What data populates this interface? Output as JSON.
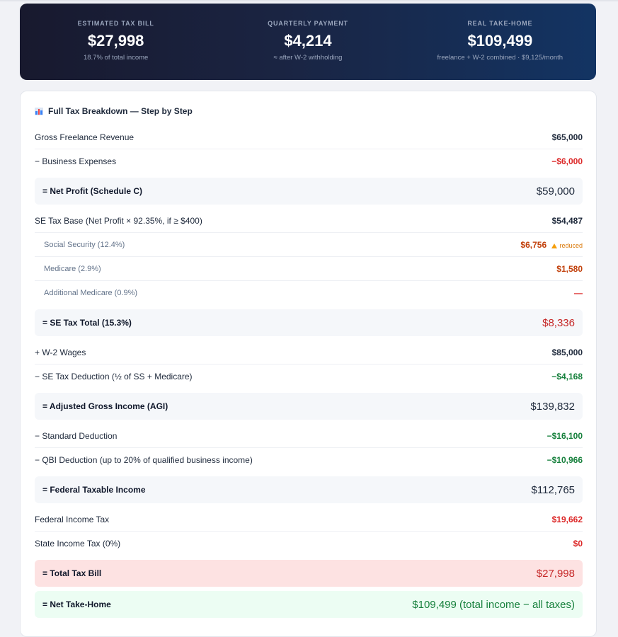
{
  "hero": {
    "stats": [
      {
        "label": "ESTIMATED TAX BILL",
        "value": "$27,998",
        "sub": "18.7% of total income"
      },
      {
        "label": "QUARTERLY PAYMENT",
        "value": "$4,214",
        "sub": "≈ after W-2 withholding"
      },
      {
        "label": "REAL TAKE-HOME",
        "value": "$109,499",
        "sub": "freelance + W-2 combined · $9,125/month"
      }
    ]
  },
  "breakdown": {
    "title": "Full Tax Breakdown — Step by Step",
    "icon": "bar-chart-icon",
    "rows": {
      "gross_revenue": {
        "label": "Gross Freelance Revenue",
        "value": "$65,000"
      },
      "business_expenses": {
        "label": "− Business Expenses",
        "value": "−$6,000"
      },
      "net_profit": {
        "label": "= Net Profit (Schedule C)",
        "value": "$59,000"
      },
      "se_tax_base": {
        "label": "SE Tax Base (Net Profit × 92.35%, if ≥ $400)",
        "value": "$54,487"
      },
      "social_security": {
        "label": "Social Security (12.4%)",
        "value": "$6,756",
        "note": "reduced"
      },
      "medicare": {
        "label": "Medicare (2.9%)",
        "value": "$1,580"
      },
      "additional_medicare": {
        "label": "Additional Medicare (0.9%)",
        "value": "—"
      },
      "se_tax_total": {
        "label": "= SE Tax Total (15.3%)",
        "value": "$8,336"
      },
      "w2_wages": {
        "label": "+ W-2 Wages",
        "value": "$85,000"
      },
      "se_tax_deduction": {
        "label": "− SE Tax Deduction (½ of SS + Medicare)",
        "value": "−$4,168"
      },
      "agi": {
        "label": "= Adjusted Gross Income (AGI)",
        "value": "$139,832"
      },
      "standard_deduction": {
        "label": "− Standard Deduction",
        "value": "−$16,100"
      },
      "qbi_deduction": {
        "label": "− QBI Deduction (up to 20% of qualified business income)",
        "value": "−$10,966"
      },
      "federal_taxable": {
        "label": "= Federal Taxable Income",
        "value": "$112,765"
      },
      "federal_income_tax": {
        "label": "Federal Income Tax",
        "value": "$19,662"
      },
      "state_income_tax": {
        "label": "State Income Tax (0%)",
        "value": "$0"
      },
      "total_tax_bill": {
        "label": "= Total Tax Bill",
        "value": "$27,998"
      },
      "net_take_home": {
        "label": "= Net Take-Home",
        "value": "$109,499 (total income − all taxes)"
      }
    }
  },
  "colors": {
    "hero_start": "#18192e",
    "hero_end": "#133463",
    "negative": "#dc2626",
    "positive": "#16803c",
    "warning": "#d97706"
  }
}
